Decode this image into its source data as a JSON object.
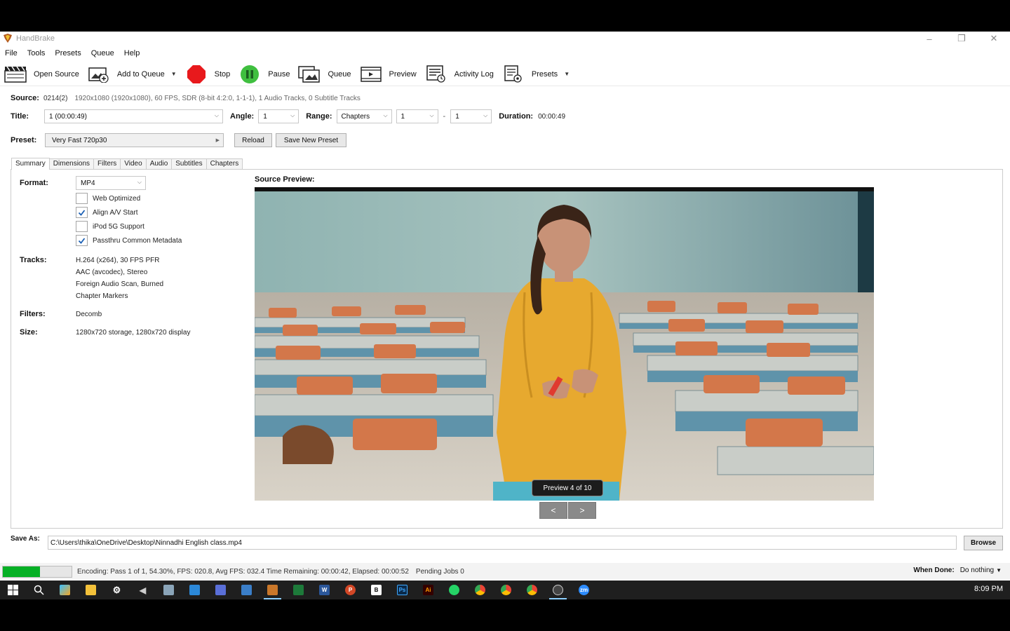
{
  "window": {
    "title": "HandBrake",
    "controls": [
      "–",
      "❐",
      "✕"
    ]
  },
  "menu": [
    "File",
    "Tools",
    "Presets",
    "Queue",
    "Help"
  ],
  "toolbar": {
    "open_source": "Open Source",
    "add_to_queue": "Add to Queue",
    "stop": "Stop",
    "pause": "Pause",
    "queue": "Queue",
    "preview": "Preview",
    "activity_log": "Activity Log",
    "presets": "Presets"
  },
  "source": {
    "label": "Source:",
    "name": "0214(2)",
    "meta": "1920x1080 (1920x1080), 60 FPS, SDR (8-bit 4:2:0, 1-1-1), 1 Audio Tracks, 0 Subtitle Tracks"
  },
  "title_row": {
    "title_label": "Title:",
    "title_value": "1  (00:00:49)",
    "angle_label": "Angle:",
    "angle_value": "1",
    "range_label": "Range:",
    "range_mode": "Chapters",
    "range_start": "1",
    "range_sep": "-",
    "range_end": "1",
    "duration_label": "Duration:",
    "duration_value": "00:00:49"
  },
  "preset": {
    "label": "Preset:",
    "value": "Very Fast 720p30",
    "reload": "Reload",
    "save_new": "Save New Preset"
  },
  "tabs": [
    "Summary",
    "Dimensions",
    "Filters",
    "Video",
    "Audio",
    "Subtitles",
    "Chapters"
  ],
  "summary": {
    "format_label": "Format:",
    "format_value": "MP4",
    "options": [
      {
        "label": "Web Optimized",
        "checked": false
      },
      {
        "label": "Align A/V Start",
        "checked": true
      },
      {
        "label": "iPod 5G Support",
        "checked": false
      },
      {
        "label": "Passthru Common Metadata",
        "checked": true
      }
    ],
    "tracks_label": "Tracks:",
    "tracks": [
      "H.264 (x264), 30 FPS PFR",
      "AAC (avcodec), Stereo",
      "Foreign Audio Scan, Burned",
      "Chapter Markers"
    ],
    "filters_label": "Filters:",
    "filters_value": "Decomb",
    "size_label": "Size:",
    "size_value": "1280x720 storage, 1280x720 display"
  },
  "preview": {
    "title": "Source Preview:",
    "counter": "Preview 4 of 10",
    "prev": "<",
    "next": ">"
  },
  "save_as": {
    "label": "Save As:",
    "path": "C:\\Users\\thika\\OneDrive\\Desktop\\Ninnadhi English class.mp4",
    "browse": "Browse"
  },
  "status": {
    "progress_percent": 54.3,
    "encoding": "Encoding: Pass 1 of 1,  54.30%, FPS: 020.8,  Avg FPS: 032.4 Time Remaining: 00:00:42,  Elapsed: 00:00:52",
    "pending": "Pending Jobs 0",
    "when_done_label": "When Done:",
    "when_done_value": "Do nothing"
  },
  "taskbar": {
    "clock": "8:09 PM"
  },
  "colors": {
    "progress_green": "#06b025",
    "stop_red": "#e8191c",
    "pause_green": "#3fbf3f"
  }
}
